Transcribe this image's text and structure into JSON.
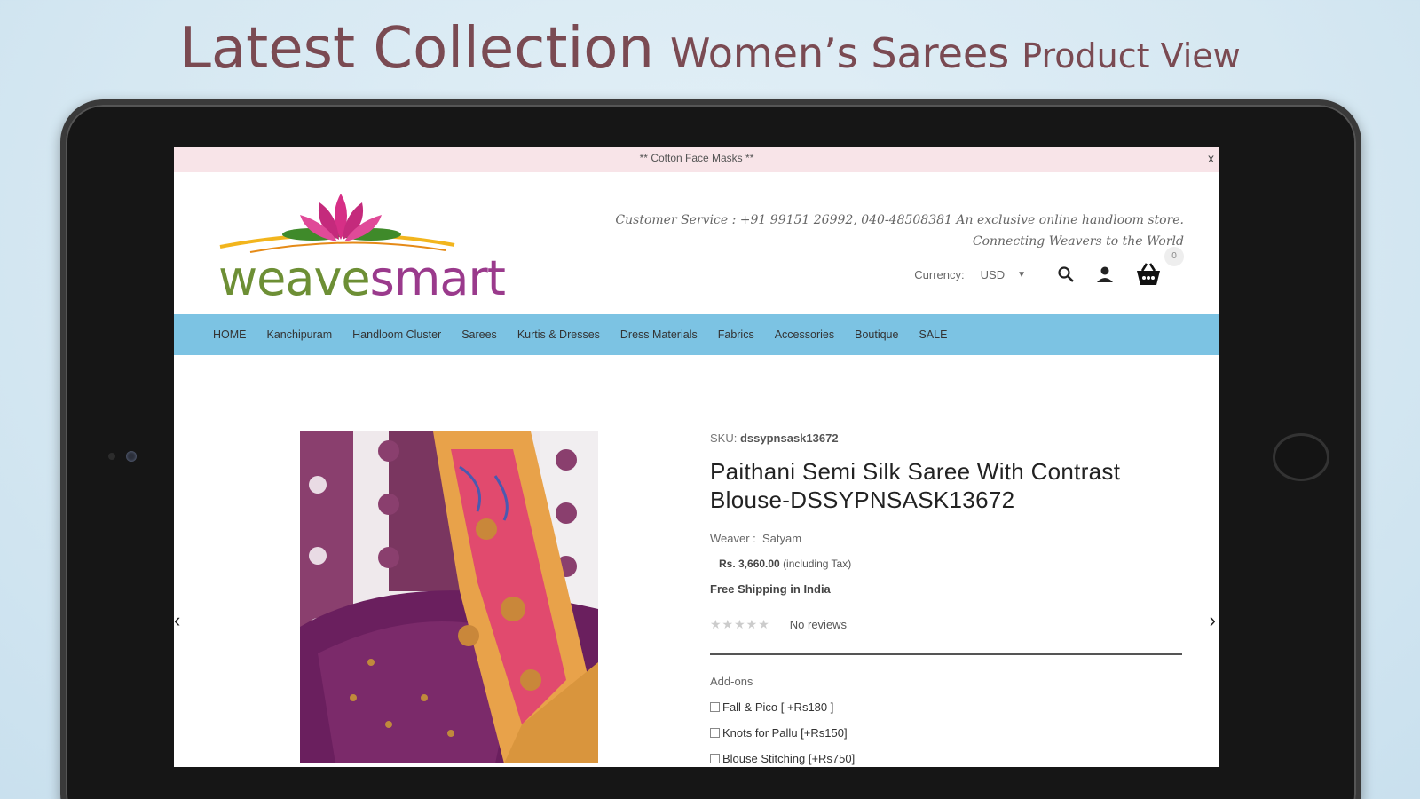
{
  "headline": {
    "part1": "Latest Collection",
    "part2": "Women’s Sarees",
    "part3": "Product View"
  },
  "promo": {
    "text": "** Cotton Face Masks **",
    "close": "x"
  },
  "header": {
    "logo_text_1": "weave",
    "logo_text_2": "smart",
    "customer_service": "Customer Service : +91 99151 26992, 040-48508381 An exclusive online handloom store. Connecting Weavers to the World",
    "cart_count": "0",
    "currency_label": "Currency:",
    "currency_value": "USD"
  },
  "nav": {
    "items": [
      "HOME",
      "Kanchipuram",
      "Handloom Cluster",
      "Sarees",
      "Kurtis & Dresses",
      "Dress Materials",
      "Fabrics",
      "Accessories",
      "Boutique",
      "SALE"
    ]
  },
  "product": {
    "sku_label": "SKU:",
    "sku_value": "dssypnsask13672",
    "title": "Paithani Semi Silk Saree With Contrast Blouse-DSSYPNSASK13672",
    "weaver_label": "Weaver :",
    "weaver_value": "Satyam",
    "price": "Rs. 3,660.00",
    "price_note": "(including Tax)",
    "shipping": "Free Shipping in India",
    "stars": "★★★★★",
    "reviews": "No reviews",
    "addons_title": "Add-ons",
    "addons": [
      "Fall & Pico [ +Rs180 ]",
      "Knots for Pallu [+Rs150]",
      "Blouse Stitching [+Rs750]"
    ],
    "prev_arrow": "‹",
    "next_arrow": "›"
  },
  "colors": {
    "nav_bg": "#7cc3e3",
    "promo_bg": "#f8e4e8",
    "headline": "#7a4a52",
    "logo_green": "#6d8f35",
    "logo_purple": "#9a3a8c"
  },
  "icons": [
    "search-icon",
    "user-icon",
    "cart-basket-icon",
    "chevron-left-icon",
    "chevron-right-icon",
    "lotus-logo-icon"
  ]
}
